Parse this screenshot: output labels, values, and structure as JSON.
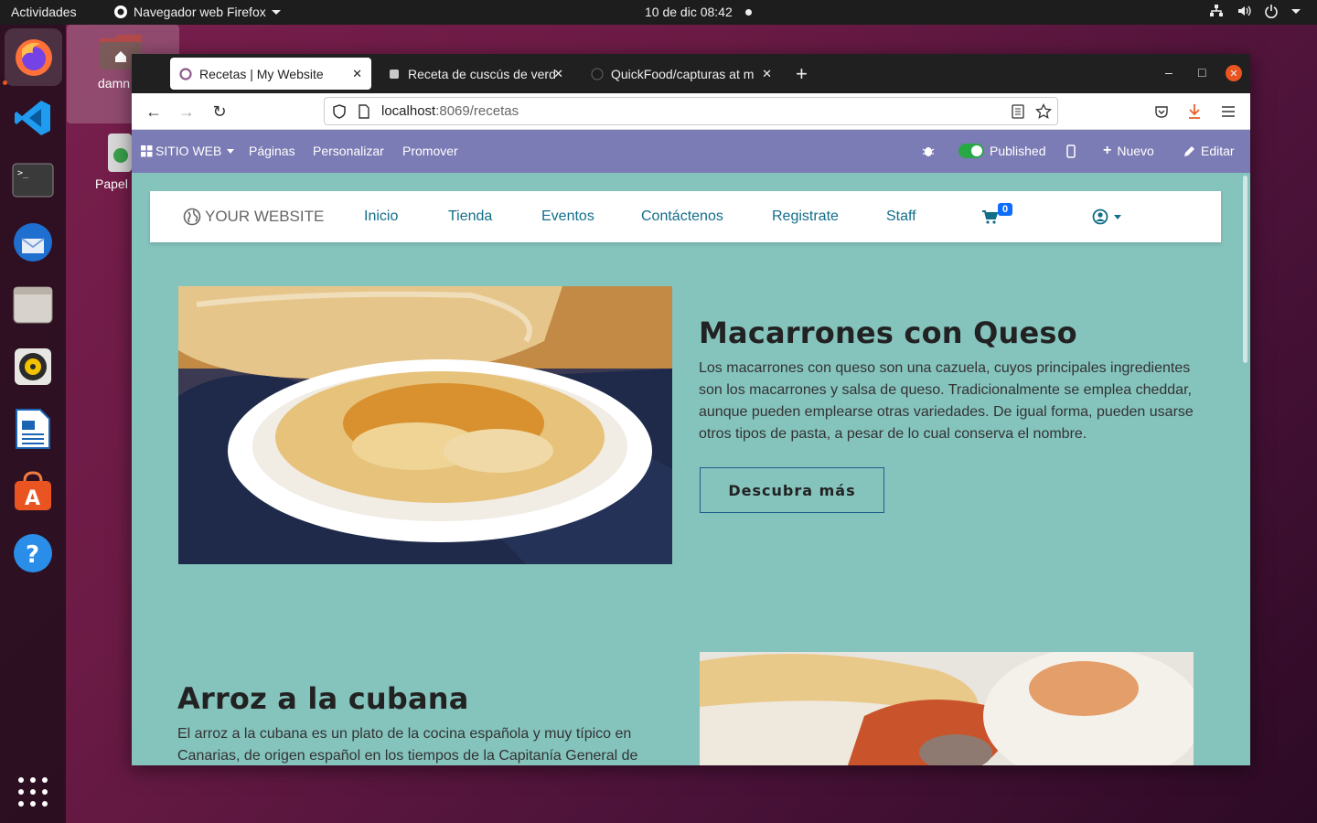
{
  "topbar": {
    "activities": "Actividades",
    "app_name": "Navegador web Firefox",
    "clock": "10 de dic  08:42"
  },
  "dock": {
    "items": [
      "firefox-icon",
      "vscode-icon",
      "terminal-icon",
      "thunderbird-icon",
      "files-icon",
      "rhythmbox-icon",
      "libreoffice-writer-icon",
      "software-center-icon",
      "help-icon"
    ]
  },
  "desktop": {
    "icons": [
      {
        "label": "damn"
      },
      {
        "label": "Papel"
      }
    ]
  },
  "browser": {
    "tabs": [
      {
        "title": "Recetas | My Website"
      },
      {
        "title": "Receta de cuscús de verd"
      },
      {
        "title": "QuickFood/capturas at m"
      }
    ],
    "url_host": "localhost",
    "url_path": ":8069/recetas"
  },
  "odoo_bar": {
    "site_menu": "SITIO WEB",
    "pages": "Páginas",
    "customize": "Personalizar",
    "promote": "Promover",
    "published": "Published",
    "new": "Nuevo",
    "edit": "Editar"
  },
  "site_nav": {
    "logo": "YOUR WEBSITE",
    "links": [
      "Inicio",
      "Tienda",
      "Eventos",
      "Contáctenos",
      "Registrate",
      "Staff"
    ],
    "cart_count": "0"
  },
  "recipes": [
    {
      "title": "Macarrones con Queso",
      "description": "Los macarrones con queso son una cazuela, cuyos principales ingredientes son los macarrones y salsa de queso. Tradicionalmente se emplea cheddar, aunque pueden emplearse otras variedades. De igual forma, pueden usarse otros tipos de pasta, a pesar de lo cual conserva el nombre.",
      "button": "Descubra más"
    },
    {
      "title": "Arroz a la cubana",
      "description": "El arroz a la cubana es un plato de la cocina española y muy típico en Canarias, de origen español en los tiempos de la Capitanía General de"
    }
  ],
  "colors": {
    "page_bg": "#85c3bd",
    "admin_bar": "#7b7bb5",
    "accent": "#136e8a"
  }
}
